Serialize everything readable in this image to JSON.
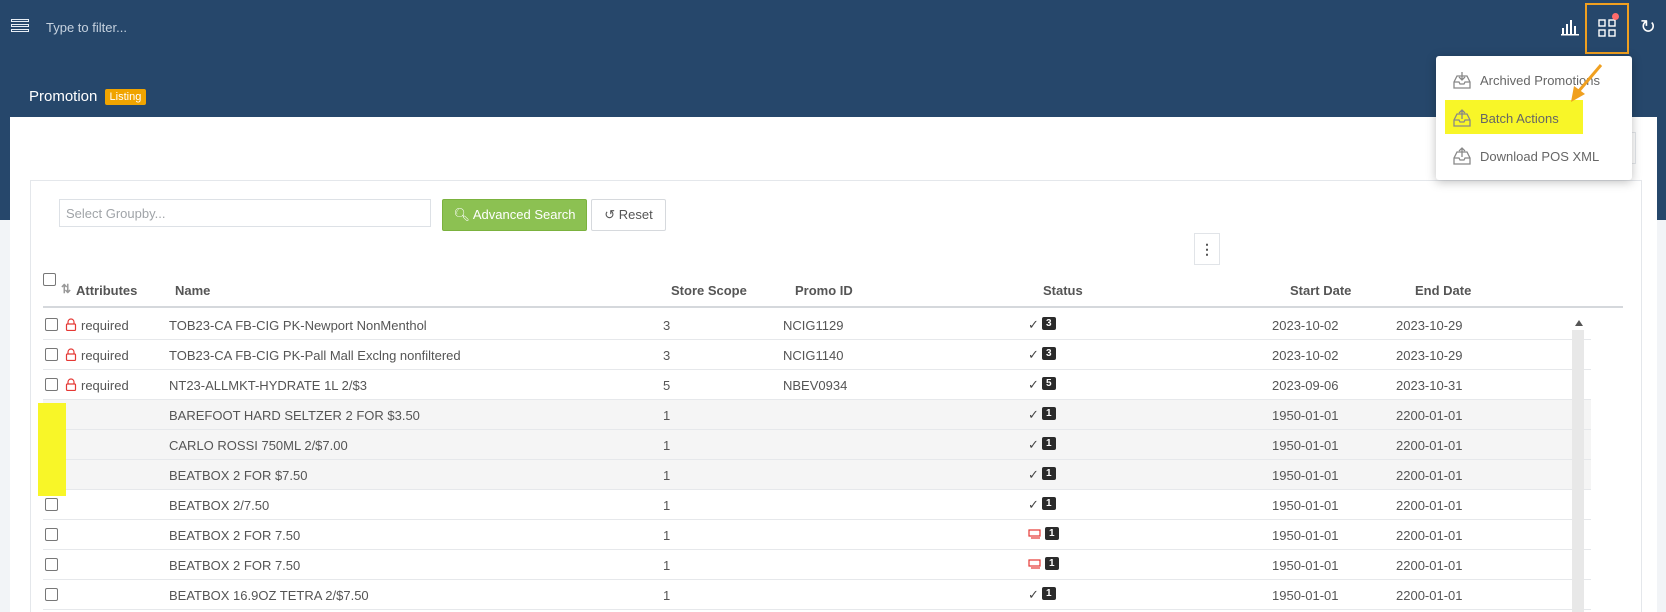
{
  "topbar": {
    "filter_placeholder": "Type to filter...",
    "icons": [
      "hamburger-icon",
      "bar-chart-icon",
      "grid-icon",
      "refresh-icon"
    ]
  },
  "page": {
    "title": "Promotion",
    "badge": "Listing"
  },
  "toolbar": {
    "groupby_placeholder": "Select Groupby...",
    "advanced_search_label": "Advanced Search",
    "reset_label": "Reset"
  },
  "dropdown": {
    "items": [
      {
        "label": "Archived Promotions",
        "icon": "archive-download-icon"
      },
      {
        "label": "Batch Actions",
        "icon": "archive-upload-icon"
      },
      {
        "label": "Download POS XML",
        "icon": "archive-upload-icon"
      }
    ]
  },
  "table": {
    "headers": {
      "attributes": "Attributes",
      "name": "Name",
      "store_scope": "Store Scope",
      "promo_id": "Promo ID",
      "status": "Status",
      "start_date": "Start Date",
      "end_date": "End Date"
    },
    "rows": [
      {
        "checked": false,
        "attribute": "required",
        "locked": true,
        "name": "TOB23-CA FB-CIG PK-Newport NonMenthol",
        "store_scope": "3",
        "promo_id": "NCIG1129",
        "status_icon": "check",
        "status_count": "3",
        "start_date": "2023-10-02",
        "end_date": "2023-10-29"
      },
      {
        "checked": false,
        "attribute": "required",
        "locked": true,
        "name": "TOB23-CA FB-CIG PK-Pall Mall Exclng nonfiltered",
        "store_scope": "3",
        "promo_id": "NCIG1140",
        "status_icon": "check",
        "status_count": "3",
        "start_date": "2023-10-02",
        "end_date": "2023-10-29"
      },
      {
        "checked": false,
        "attribute": "required",
        "locked": true,
        "name": "NT23-ALLMKT-HYDRATE 1L 2/$3",
        "store_scope": "5",
        "promo_id": "NBEV0934",
        "status_icon": "check",
        "status_count": "5",
        "start_date": "2023-09-06",
        "end_date": "2023-10-31"
      },
      {
        "checked": true,
        "attribute": "",
        "locked": false,
        "name": "BAREFOOT HARD SELTZER 2 FOR $3.50",
        "store_scope": "1",
        "promo_id": "",
        "status_icon": "check",
        "status_count": "1",
        "start_date": "1950-01-01",
        "end_date": "2200-01-01"
      },
      {
        "checked": true,
        "attribute": "",
        "locked": false,
        "name": "CARLO ROSSI 750ML 2/$7.00",
        "store_scope": "1",
        "promo_id": "",
        "status_icon": "check",
        "status_count": "1",
        "start_date": "1950-01-01",
        "end_date": "2200-01-01"
      },
      {
        "checked": true,
        "attribute": "",
        "locked": false,
        "name": "BEATBOX 2 FOR $7.50",
        "store_scope": "1",
        "promo_id": "",
        "status_icon": "check",
        "status_count": "1",
        "start_date": "1950-01-01",
        "end_date": "2200-01-01"
      },
      {
        "checked": false,
        "attribute": "",
        "locked": false,
        "name": "BEATBOX 2/7.50",
        "store_scope": "1",
        "promo_id": "",
        "status_icon": "check",
        "status_count": "1",
        "start_date": "1950-01-01",
        "end_date": "2200-01-01"
      },
      {
        "checked": false,
        "attribute": "",
        "locked": false,
        "name": "BEATBOX 2 FOR 7.50",
        "store_scope": "1",
        "promo_id": "",
        "status_icon": "error",
        "status_count": "1",
        "start_date": "1950-01-01",
        "end_date": "2200-01-01"
      },
      {
        "checked": false,
        "attribute": "",
        "locked": false,
        "name": "BEATBOX 2 FOR 7.50",
        "store_scope": "1",
        "promo_id": "",
        "status_icon": "error",
        "status_count": "1",
        "start_date": "1950-01-01",
        "end_date": "2200-01-01"
      },
      {
        "checked": false,
        "attribute": "",
        "locked": false,
        "name": "BEATBOX 16.9OZ TETRA 2/$7.50",
        "store_scope": "1",
        "promo_id": "",
        "status_icon": "check",
        "status_count": "1",
        "start_date": "1950-01-01",
        "end_date": "2200-01-01"
      }
    ]
  },
  "colors": {
    "header_bg": "#26476b",
    "accent_green": "#8cc152",
    "badge_orange": "#f0a400",
    "highlight": "#f8f628",
    "annotation_orange": "#f0a020"
  }
}
